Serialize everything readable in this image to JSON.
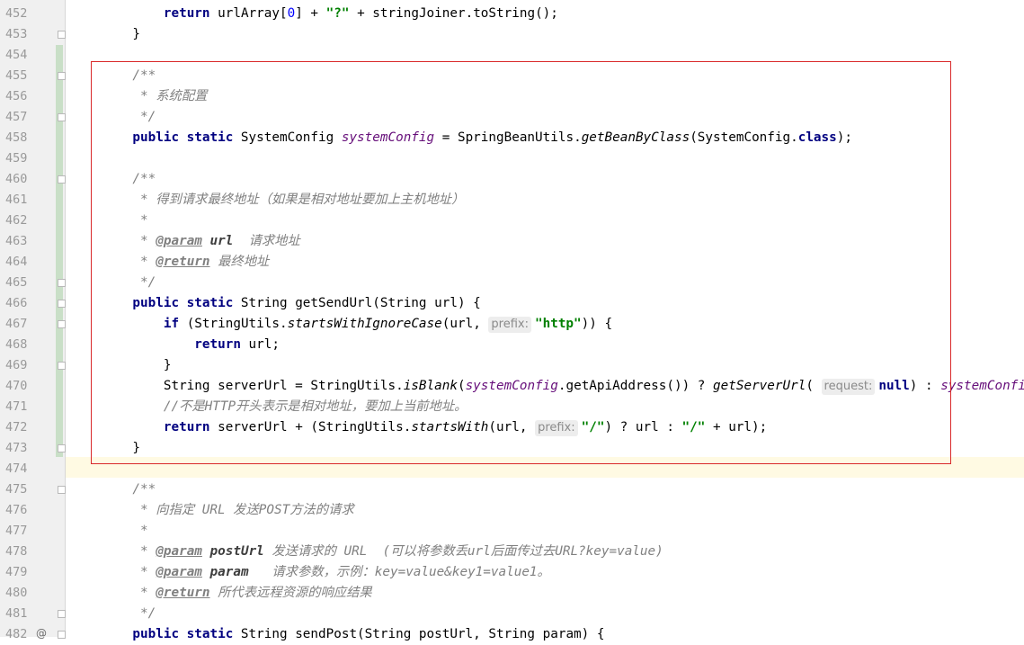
{
  "editor": {
    "lines": [
      {
        "no": "452",
        "fold": false,
        "tokens": [
          [
            "plain",
            "        "
          ],
          [
            "kw",
            "return"
          ],
          [
            "plain",
            " urlArray["
          ],
          [
            "num",
            "0"
          ],
          [
            "plain",
            "] + "
          ],
          [
            "str",
            "\"?\""
          ],
          [
            "plain",
            " + stringJoiner.toString();"
          ]
        ]
      },
      {
        "no": "453",
        "fold": true,
        "tokens": [
          [
            "plain",
            "    }"
          ]
        ]
      },
      {
        "no": "454",
        "fold": false,
        "tokens": []
      },
      {
        "no": "455",
        "fold": true,
        "tokens": [
          [
            "cmt",
            "    /**"
          ]
        ]
      },
      {
        "no": "456",
        "fold": false,
        "tokens": [
          [
            "cmt",
            "     * 系统配置"
          ]
        ]
      },
      {
        "no": "457",
        "fold": true,
        "tokens": [
          [
            "cmt",
            "     */"
          ]
        ]
      },
      {
        "no": "458",
        "fold": false,
        "tokens": [
          [
            "kw",
            "    public static"
          ],
          [
            "plain",
            " SystemConfig "
          ],
          [
            "field",
            "systemConfig"
          ],
          [
            "plain",
            " = SpringBeanUtils."
          ],
          [
            "smethod",
            "getBeanByClass"
          ],
          [
            "plain",
            "(SystemConfig."
          ],
          [
            "kw",
            "class"
          ],
          [
            "plain",
            ");"
          ]
        ]
      },
      {
        "no": "459",
        "fold": false,
        "tokens": []
      },
      {
        "no": "460",
        "fold": true,
        "tokens": [
          [
            "cmt",
            "    /**"
          ]
        ]
      },
      {
        "no": "461",
        "fold": false,
        "tokens": [
          [
            "cmt",
            "     * 得到请求最终地址（如果是相对地址要加上主机地址）"
          ]
        ]
      },
      {
        "no": "462",
        "fold": false,
        "tokens": [
          [
            "cmt",
            "     *"
          ]
        ]
      },
      {
        "no": "463",
        "fold": false,
        "tokens": [
          [
            "cmt",
            "     * "
          ],
          [
            "tag",
            "@param"
          ],
          [
            "cmt",
            " "
          ],
          [
            "tagval",
            "url"
          ],
          [
            "cmt",
            "  请求地址"
          ]
        ]
      },
      {
        "no": "464",
        "fold": false,
        "tokens": [
          [
            "cmt",
            "     * "
          ],
          [
            "tag",
            "@return"
          ],
          [
            "cmt",
            " 最终地址"
          ]
        ]
      },
      {
        "no": "465",
        "fold": true,
        "tokens": [
          [
            "cmt",
            "     */"
          ]
        ]
      },
      {
        "no": "466",
        "fold": true,
        "tokens": [
          [
            "kw",
            "    public static"
          ],
          [
            "plain",
            " String getSendUrl(String url) {"
          ]
        ]
      },
      {
        "no": "467",
        "fold": true,
        "tokens": [
          [
            "plain",
            "        "
          ],
          [
            "kw",
            "if"
          ],
          [
            "plain",
            " (StringUtils."
          ],
          [
            "smethod",
            "startsWithIgnoreCase"
          ],
          [
            "plain",
            "(url, "
          ],
          [
            "hint",
            "prefix:"
          ],
          [
            "str",
            "\"http\""
          ],
          [
            "plain",
            ")) {"
          ]
        ]
      },
      {
        "no": "468",
        "fold": false,
        "tokens": [
          [
            "plain",
            "            "
          ],
          [
            "kw",
            "return"
          ],
          [
            "plain",
            " url;"
          ]
        ]
      },
      {
        "no": "469",
        "fold": true,
        "tokens": [
          [
            "plain",
            "        }"
          ]
        ]
      },
      {
        "no": "470",
        "fold": false,
        "tokens": [
          [
            "plain",
            "        String serverUrl = StringUtils."
          ],
          [
            "smethod",
            "isBlank"
          ],
          [
            "plain",
            "("
          ],
          [
            "field",
            "systemConfig"
          ],
          [
            "plain",
            ".getApiAddress()) ? "
          ],
          [
            "smethod",
            "getServerUrl"
          ],
          [
            "plain",
            "( "
          ],
          [
            "hint",
            "request:"
          ],
          [
            "kw",
            "null"
          ],
          [
            "plain",
            ") : "
          ],
          [
            "field",
            "systemConfig"
          ]
        ]
      },
      {
        "no": "471",
        "fold": false,
        "tokens": [
          [
            "cmt",
            "        //不是HTTP开头表示是相对地址，要加上当前地址。"
          ]
        ]
      },
      {
        "no": "472",
        "fold": false,
        "tokens": [
          [
            "plain",
            "        "
          ],
          [
            "kw",
            "return"
          ],
          [
            "plain",
            " serverUrl + (StringUtils."
          ],
          [
            "smethod",
            "startsWith"
          ],
          [
            "plain",
            "(url, "
          ],
          [
            "hint",
            "prefix:"
          ],
          [
            "str",
            "\"/\""
          ],
          [
            "plain",
            ") ? url : "
          ],
          [
            "str",
            "\"/\""
          ],
          [
            "plain",
            " + url);"
          ]
        ]
      },
      {
        "no": "473",
        "fold": true,
        "tokens": [
          [
            "plain",
            "    }"
          ]
        ]
      },
      {
        "no": "474",
        "fold": false,
        "tokens": []
      },
      {
        "no": "475",
        "fold": true,
        "tokens": [
          [
            "cmt",
            "    /**"
          ]
        ]
      },
      {
        "no": "476",
        "fold": false,
        "tokens": [
          [
            "cmt",
            "     * 向指定 URL 发送POST方法的请求"
          ]
        ]
      },
      {
        "no": "477",
        "fold": false,
        "tokens": [
          [
            "cmt",
            "     *"
          ]
        ]
      },
      {
        "no": "478",
        "fold": false,
        "tokens": [
          [
            "cmt",
            "     * "
          ],
          [
            "tag",
            "@param"
          ],
          [
            "cmt",
            " "
          ],
          [
            "tagval",
            "postUrl"
          ],
          [
            "cmt",
            " 发送请求的 URL  (可以将参数丢url后面传过去URL?key=value)"
          ]
        ]
      },
      {
        "no": "479",
        "fold": false,
        "tokens": [
          [
            "cmt",
            "     * "
          ],
          [
            "tag",
            "@param"
          ],
          [
            "cmt",
            " "
          ],
          [
            "tagval",
            "param"
          ],
          [
            "cmt",
            "   请求参数，示例：key=value&key1=value1。"
          ]
        ]
      },
      {
        "no": "480",
        "fold": false,
        "tokens": [
          [
            "cmt",
            "     * "
          ],
          [
            "tag",
            "@return"
          ],
          [
            "cmt",
            " 所代表远程资源的响应结果"
          ]
        ]
      },
      {
        "no": "481",
        "fold": true,
        "tokens": [
          [
            "cmt",
            "     */"
          ]
        ]
      },
      {
        "no": "482",
        "fold": true,
        "override": "@",
        "tokens": [
          [
            "kw",
            "    public static"
          ],
          [
            "plain",
            " String sendPost(String postUrl, String param) {"
          ]
        ]
      }
    ]
  },
  "colors": {
    "keyword": "#000080",
    "string": "#008000",
    "number": "#0000ff",
    "field": "#660e7a",
    "comment": "#808080",
    "highlight_border": "#d9292a",
    "caret_row": "#fffae3",
    "vcs_added": "#c9dfc7"
  },
  "icons": {
    "fold": "fold-marker-icon",
    "override": "override-icon"
  }
}
